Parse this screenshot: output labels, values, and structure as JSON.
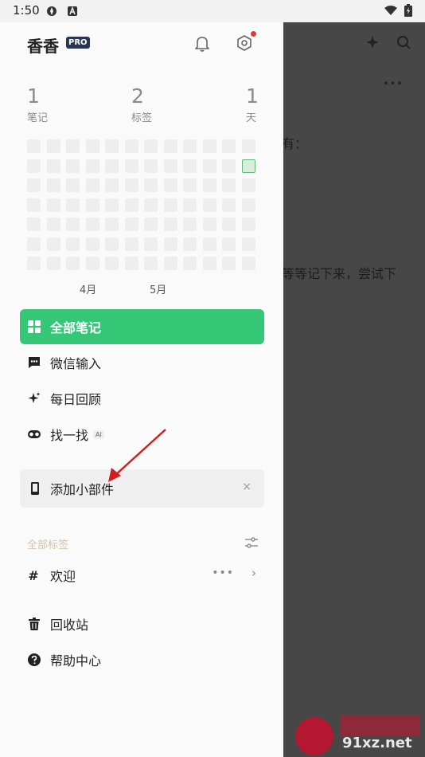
{
  "status_bar": {
    "time": "1:50"
  },
  "drawer": {
    "user_name": "香香",
    "pro_badge": "PRO",
    "stats": [
      {
        "value": "1",
        "label": "笔记"
      },
      {
        "value": "2",
        "label": "标签"
      },
      {
        "value": "1",
        "label": "天"
      }
    ],
    "heatmap": {
      "rows": 7,
      "cols": 12,
      "active_cell": {
        "row": 2,
        "col": 12
      }
    },
    "months": [
      "4月",
      "5月"
    ],
    "nav": [
      {
        "label": "全部笔记",
        "icon": "grid-icon",
        "active": true
      },
      {
        "label": "微信输入",
        "icon": "chat-icon",
        "active": false
      },
      {
        "label": "每日回顾",
        "icon": "sparkle-icon",
        "active": false
      },
      {
        "label": "找一找",
        "icon": "glasses-icon",
        "active": false,
        "tag": "AI"
      }
    ],
    "widget_card": {
      "label": "添加小部件",
      "close": "×"
    },
    "tags": {
      "header": "全部标签",
      "items": [
        {
          "hash": "#",
          "label": "欢迎",
          "more": "•••",
          "chevron": "›"
        }
      ]
    },
    "bottom": [
      {
        "label": "回收站",
        "icon": "trash-icon"
      },
      {
        "label": "帮助中心",
        "icon": "help-icon"
      }
    ]
  },
  "background_app": {
    "more": "•••",
    "text_fragment_1": "有：",
    "text_fragment_2": "等等记下来，尝试下"
  },
  "watermark": {
    "text": "91xz.net"
  },
  "colors": {
    "accent": "#34c776",
    "pro_badge": "#2a3550",
    "notification_dot": "#e53935"
  }
}
